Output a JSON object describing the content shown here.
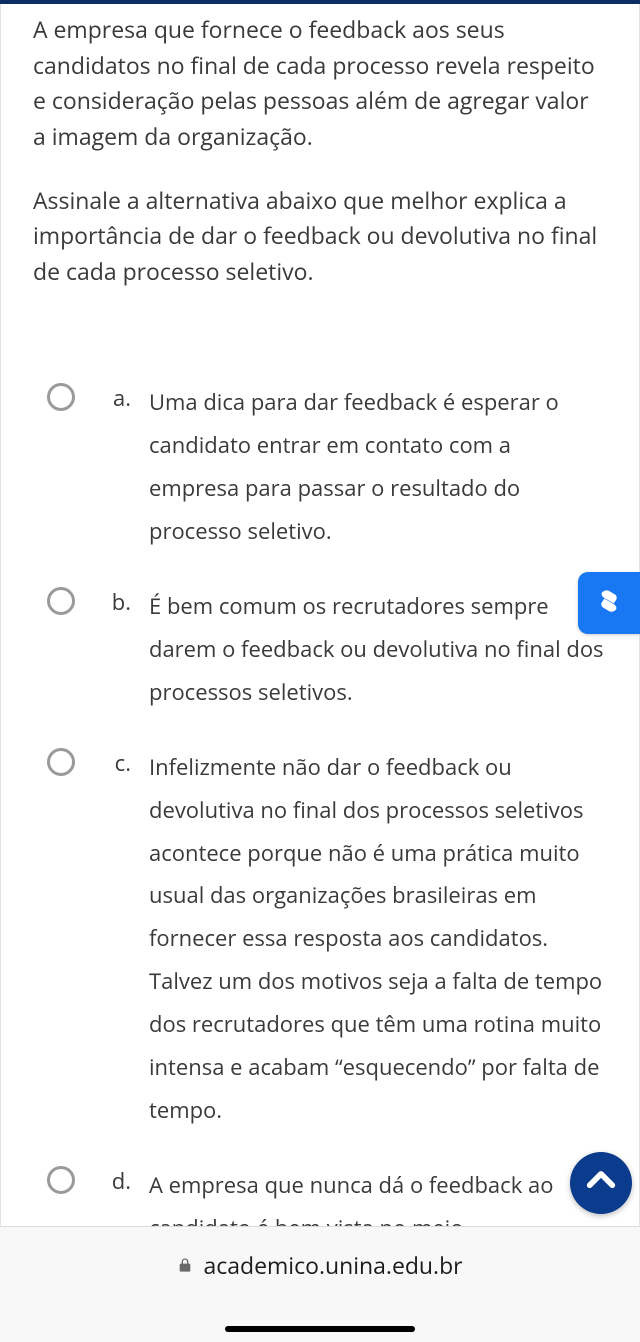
{
  "question": {
    "paragraph1": "A empresa que fornece o feedback aos seus candidatos no final de cada processo revela respeito e consideração pelas pessoas além de agregar valor a imagem da organização.",
    "paragraph2": "Assinale a alternativa abaixo que melhor explica a importância de dar o feedback ou devolutiva no final de cada processo seletivo."
  },
  "options": [
    {
      "letter": "a.",
      "text": "Uma dica para dar feedback é esperar o candidato entrar em contato com a empresa para passar o resultado do processo seletivo."
    },
    {
      "letter": "b.",
      "text": "É bem comum os recrutadores sempre darem o feedback ou devolutiva no final dos processos seletivos."
    },
    {
      "letter": "c.",
      "text": "Infelizmente não dar o feedback ou devolutiva no final dos processos seletivos acontece porque não é uma prática muito usual das organizações brasileiras em fornecer essa resposta aos candidatos. Talvez um dos motivos seja a falta de tempo dos recrutadores que têm uma rotina muito intensa e acabam “esquecendo” por falta de tempo."
    },
    {
      "letter": "d.",
      "text": "A empresa que nunca dá o feedback ao candidato é bem vista no meio"
    }
  ],
  "chrome": {
    "url": "academico.unina.edu.br"
  }
}
